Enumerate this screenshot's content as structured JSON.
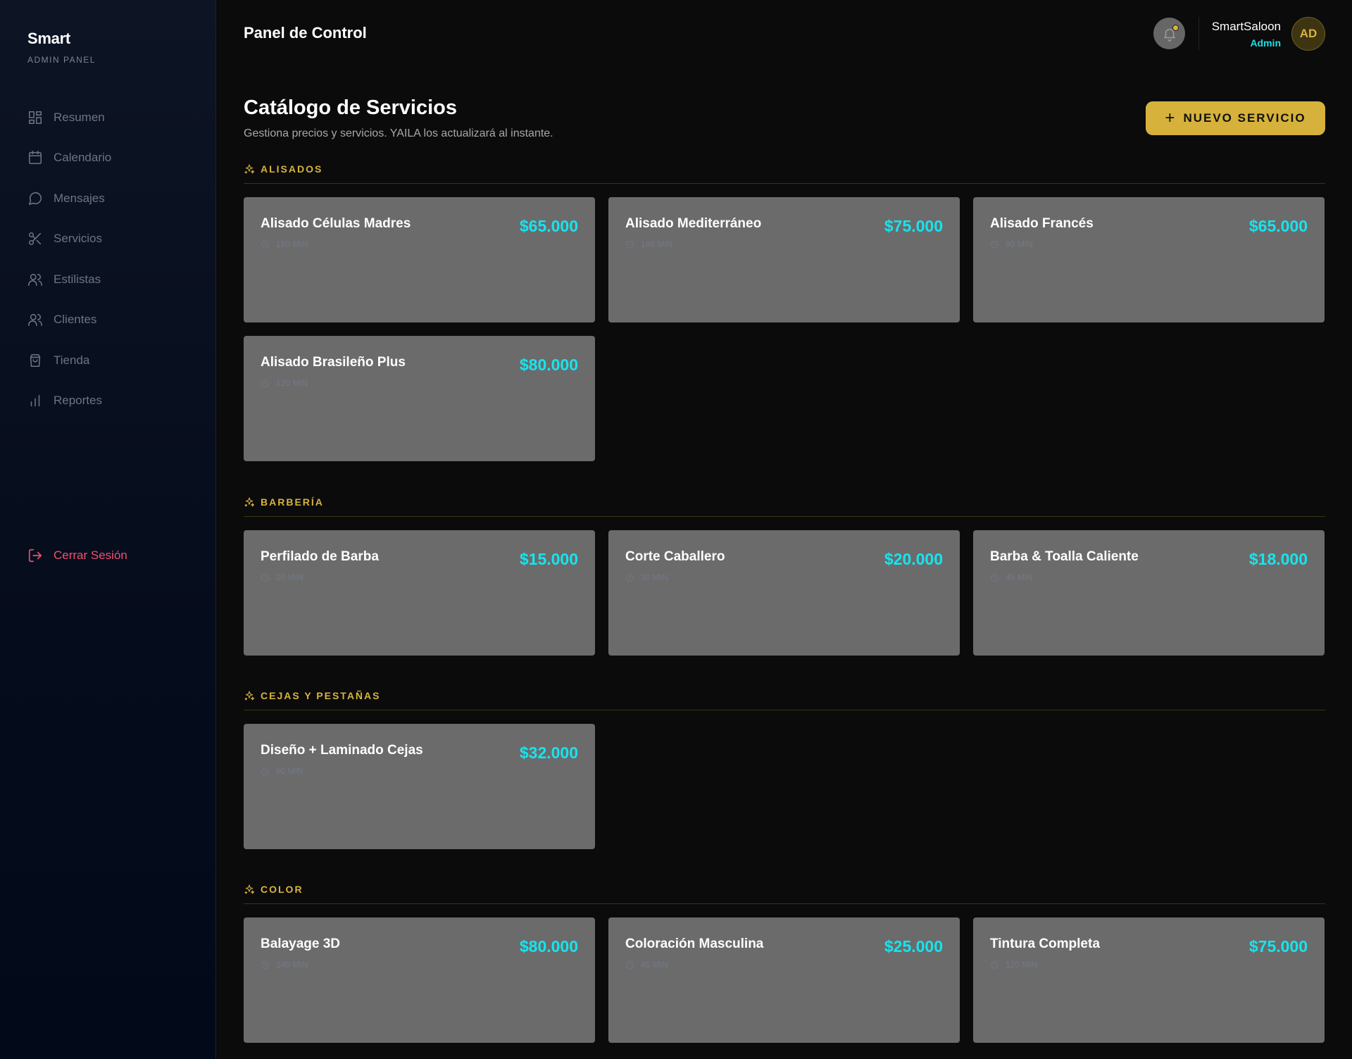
{
  "brand": {
    "title": "Smart",
    "subtitle": "ADMIN PANEL"
  },
  "nav": [
    {
      "label": "Resumen",
      "icon": "grid-icon"
    },
    {
      "label": "Calendario",
      "icon": "calendar-icon"
    },
    {
      "label": "Mensajes",
      "icon": "message-icon"
    },
    {
      "label": "Servicios",
      "icon": "scissors-icon"
    },
    {
      "label": "Estilistas",
      "icon": "users-icon"
    },
    {
      "label": "Clientes",
      "icon": "users-icon"
    },
    {
      "label": "Tienda",
      "icon": "bag-icon"
    },
    {
      "label": "Reportes",
      "icon": "bar-chart-icon"
    }
  ],
  "logout": {
    "label": "Cerrar Sesión"
  },
  "header": {
    "title": "Panel de Control",
    "user_name": "SmartSaloon",
    "user_role": "Admin",
    "avatar_initials": "AD"
  },
  "main": {
    "title": "Catálogo de Servicios",
    "subtitle": "Gestiona precios y servicios. YAILA los actualizará al instante.",
    "new_button": "NUEVO SERVICIO"
  },
  "colors": {
    "accent": "#d6b23c",
    "price": "#17e4ee",
    "card": "#6b6b6b",
    "logout": "#f0506e"
  },
  "categories": [
    {
      "name": "ALISADOS",
      "services": [
        {
          "name": "Alisado Células Madres",
          "price": "$65.000",
          "duration": "150 MIN"
        },
        {
          "name": "Alisado Mediterráneo",
          "price": "$75.000",
          "duration": "180 MIN"
        },
        {
          "name": "Alisado Francés",
          "price": "$65.000",
          "duration": "90 MIN"
        },
        {
          "name": "Alisado Brasileño Plus",
          "price": "$80.000",
          "duration": "120 MIN"
        }
      ]
    },
    {
      "name": "BARBERÍA",
      "services": [
        {
          "name": "Perfilado de Barba",
          "price": "$15.000",
          "duration": "20 MIN"
        },
        {
          "name": "Corte Caballero",
          "price": "$20.000",
          "duration": "30 MIN"
        },
        {
          "name": "Barba & Toalla Caliente",
          "price": "$18.000",
          "duration": "45 MIN"
        }
      ]
    },
    {
      "name": "CEJAS Y PESTAÑAS",
      "services": [
        {
          "name": "Diseño + Laminado Cejas",
          "price": "$32.000",
          "duration": "60 MIN"
        }
      ]
    },
    {
      "name": "COLOR",
      "services": [
        {
          "name": "Balayage 3D",
          "price": "$80.000",
          "duration": "240 MIN"
        },
        {
          "name": "Coloración Masculina",
          "price": "$25.000",
          "duration": "45 MIN"
        },
        {
          "name": "Tintura Completa",
          "price": "$75.000",
          "duration": "120 MIN"
        }
      ]
    }
  ]
}
